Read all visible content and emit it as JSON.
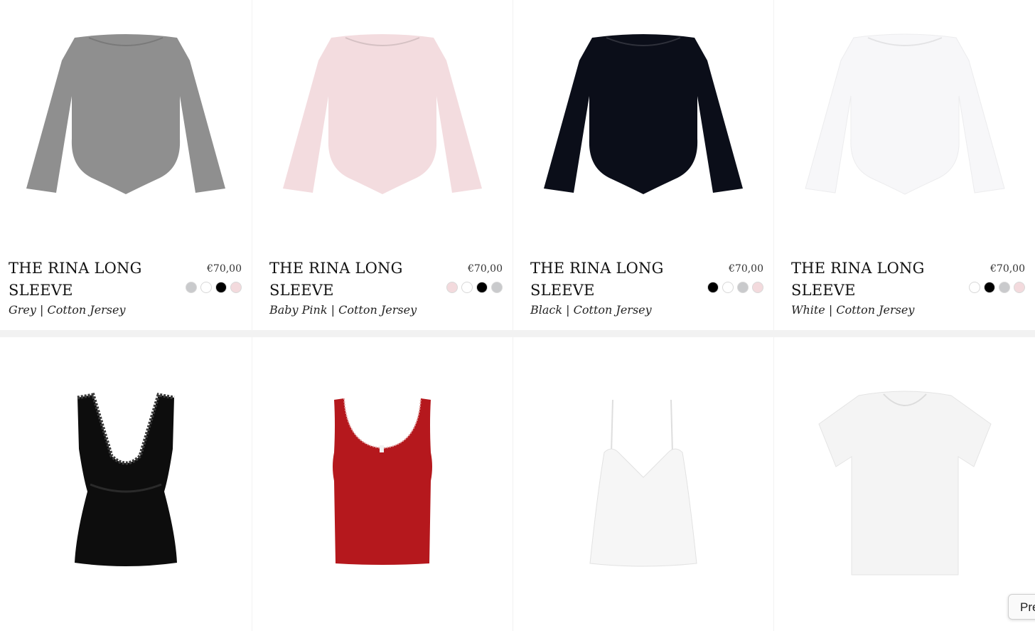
{
  "products_row1": [
    {
      "title_line1": "THE RINA LONG",
      "title_line2": "SLEEVE",
      "color_name": "Grey",
      "material": "Cotton Jersey",
      "price": "€70,00",
      "garment_color": "#8f8f8f",
      "swatches": [
        "#c9cacc",
        "#ffffff",
        "#000000",
        "#f3dadd"
      ]
    },
    {
      "title_line1": "THE RINA LONG",
      "title_line2": "SLEEVE",
      "color_name": "Baby Pink",
      "material": "Cotton Jersey",
      "price": "€70,00",
      "garment_color": "#f3dcdf",
      "swatches": [
        "#f3dadd",
        "#ffffff",
        "#000000",
        "#c9cacc"
      ]
    },
    {
      "title_line1": "THE RINA LONG",
      "title_line2": "SLEEVE",
      "color_name": "Black",
      "material": "Cotton Jersey",
      "price": "€70,00",
      "garment_color": "#0b0e19",
      "swatches": [
        "#000000",
        "#ffffff",
        "#c9cacc",
        "#f3dadd"
      ]
    },
    {
      "title_line1": "THE RINA LONG",
      "title_line2": "SLEEVE",
      "color_name": "White",
      "material": "Cotton Jersey",
      "price": "€70,00",
      "garment_color": "#f7f7f9",
      "swatches": [
        "#ffffff",
        "#000000",
        "#c9cacc",
        "#f3dadd"
      ]
    }
  ],
  "products_row2": [
    {
      "item": "black-lace-camisole",
      "garment_color": "#0d0d0d"
    },
    {
      "item": "red-pointelle-tank",
      "garment_color": "#b5181d"
    },
    {
      "item": "white-pointelle-cami",
      "garment_color": "#f6f6f6"
    },
    {
      "item": "white-baby-tee",
      "garment_color": "#f4f4f4"
    }
  ],
  "preview_button": {
    "label": "Pre"
  },
  "separator": "|"
}
